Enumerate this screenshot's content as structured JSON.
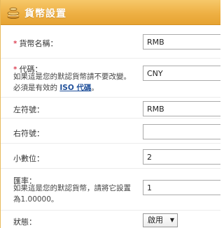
{
  "header": {
    "title": "貨幣設置",
    "icon": "coin-stack-icon",
    "accent_color": "#eeb044"
  },
  "form": {
    "currency_name": {
      "required_mark": "*",
      "label": "貨幣名稱：",
      "value": "RMB"
    },
    "code": {
      "required_mark": "*",
      "label": "代碼：",
      "help_line1": "如果這是您的默認貨幣請不要改變。",
      "help_line2_prefix": "必須是有效的",
      "help_link": "ISO 代碼",
      "help_line2_suffix": "。",
      "value": "CNY"
    },
    "left_symbol": {
      "label": "左符號：",
      "value": "RMB"
    },
    "right_symbol": {
      "label": "右符號：",
      "value": ""
    },
    "decimal_places": {
      "label": "小數位：",
      "value": "2"
    },
    "exchange_rate": {
      "label": "匯率：",
      "help_line1": "如果這是您的默認貨幣，請將它設置",
      "help_line2": "為1.00000。",
      "value": "1"
    },
    "status": {
      "label": "狀態：",
      "selected": "啟用"
    }
  }
}
